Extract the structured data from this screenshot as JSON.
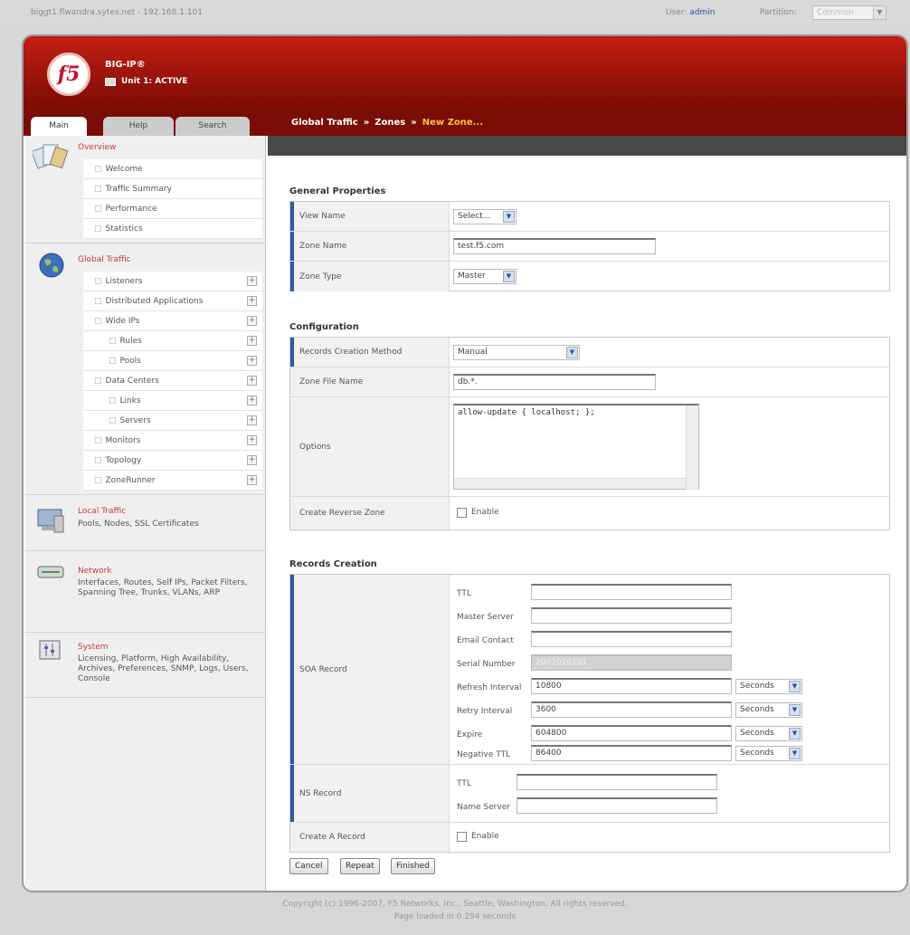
{
  "topbar": {
    "host": "biggt1.flwandra.sytes.net - 192.168.1.101",
    "user_label": "User:",
    "user_value": "admin",
    "partition_label": "Partition:",
    "partition_value": "Common"
  },
  "banner": {
    "logo_text": "f5",
    "product": "BIG-IP®",
    "unit_status": "Unit 1: ACTIVE"
  },
  "tabs": {
    "main": "Main",
    "help": "Help",
    "search": "Search"
  },
  "breadcrumb": {
    "part1": "Global Traffic",
    "sep": "»",
    "part2": "Zones",
    "current": "New Zone..."
  },
  "sidebar": {
    "overview": {
      "title": "Overview",
      "items": [
        "Welcome",
        "Traffic Summary",
        "Performance",
        "Statistics"
      ]
    },
    "global_traffic": {
      "title": "Global Traffic",
      "items": [
        "Listeners",
        "Distributed Applications",
        "Wide IPs",
        "Rules",
        "Pools",
        "Data Centers",
        "Links",
        "Servers",
        "Monitors",
        "Topology",
        "ZoneRunner"
      ]
    },
    "local_traffic": {
      "title": "Local Traffic",
      "desc": "Pools, Nodes, SSL Certificates"
    },
    "network": {
      "title": "Network",
      "desc": "Interfaces, Routes, Self IPs, Packet Filters, Spanning Tree, Trunks, VLANs, ARP"
    },
    "system": {
      "title": "System",
      "desc": "Licensing, Platform, High Availability, Archives, Preferences, SNMP, Logs, Users, Console"
    }
  },
  "general": {
    "title": "General Properties",
    "view_name_label": "View Name",
    "view_name_value": "Select...",
    "zone_name_label": "Zone Name",
    "zone_name_value": "test.f5.com",
    "zone_type_label": "Zone Type",
    "zone_type_value": "Master"
  },
  "config": {
    "title": "Configuration",
    "method_label": "Records Creation Method",
    "method_value": "Manual",
    "file_label": "Zone File Name",
    "file_value": "db.*.",
    "options_label": "Options",
    "options_value": "allow-update { localhost; };",
    "reverse_label": "Create Reverse Zone",
    "reverse_check": "Enable"
  },
  "records": {
    "title": "Records Creation",
    "soa_label": "SOA Record",
    "ttl_label": "TTL",
    "master_label": "Master Server",
    "email_label": "Email Contact",
    "serial_label": "Serial Number",
    "serial_value": "2007010101",
    "refresh_label": "Refresh Interval",
    "refresh_value": "10800",
    "retry_label": "Retry Interval",
    "retry_value": "3600",
    "expire_label": "Expire",
    "expire_value": "604800",
    "negttl_label": "Negative TTL",
    "negttl_value": "86400",
    "unit": "Seconds",
    "ns_label": "NS Record",
    "ns_ttl_label": "TTL",
    "ns_name_label": "Name Server",
    "arec_label": "Create A Record",
    "arec_check": "Enable"
  },
  "buttons": {
    "cancel": "Cancel",
    "repeat": "Repeat",
    "finished": "Finished"
  },
  "footer": {
    "copyright": "Copyright (c) 1996-2007, F5 Networks, Inc., Seattle, Washington. All rights reserved.",
    "loaded": "Page loaded in 0.294 seconds"
  },
  "colors": {
    "banner": "#8e1008",
    "accent": "#2e5aa3",
    "breadcrumb_current": "#f6c14a"
  }
}
